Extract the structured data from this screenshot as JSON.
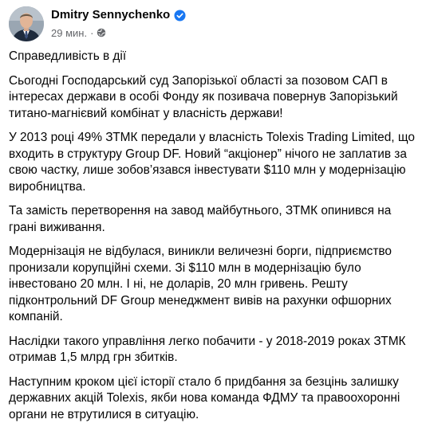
{
  "post": {
    "author": "Dmitry Sennychenko",
    "timestamp": "29 мин.",
    "separator": "·",
    "paragraphs": [
      "Справедливість в дії",
      "Сьогодні Господарський суд Запорізької області за позовом САП в інтересах держави в особі Фонду як позивача повернув Запорізький титано-магнієвий комбінат у власність держави!",
      "У 2013 році 49% ЗТМК передали у власність Tolexis Trading Limited, що входить в структуру Group DF. Новий “акціонер” нічого не заплатив за свою частку, лише зобов’язався інвестувати $110 млн у модернізацію виробництва.",
      "Та замість перетворення на завод майбутнього, ЗТМК опинився на грані виживання.",
      "Модернізація не відбулася, виникли величезні борги, підприємство пронизали корупційні схеми. Зі $110 млн в модернізацію було інвестовано 20 млн. І ні, не доларів, 20 млн гривень. Решту підконтрольний DF Group менеджмент вивів на рахунки офшорних компаній.",
      "Наслідки такого управління легко побачити - у 2018-2019 роках ЗТМК отримав 1,5 млрд грн збитків.",
      "Наступним кроком цієї історії стало б придбання за безцінь залишку державних акцій Tolexis, якби нова команда ФДМУ та правоохоронні органи не втрутилися в ситуацію."
    ],
    "icons": {
      "verified": "verified-badge-icon",
      "audience": "globe-icon"
    },
    "colors": {
      "verified_blue": "#1877f2",
      "meta_gray": "#65676b",
      "text": "#050505"
    }
  }
}
